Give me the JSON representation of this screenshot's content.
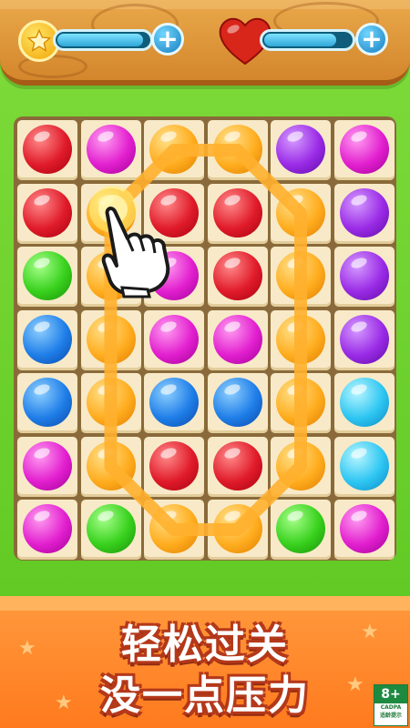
{
  "hud": {
    "star_meter_level": 0.9,
    "life_meter_level": 0.8,
    "star_plus": "+",
    "life_plus": "+"
  },
  "board": {
    "rows": 7,
    "cols": 6,
    "grid": [
      [
        "red",
        "magenta",
        "orange",
        "orange",
        "purple",
        "magenta"
      ],
      [
        "red",
        "orange",
        "red",
        "red",
        "orange",
        "purple"
      ],
      [
        "green",
        "orange",
        "magenta",
        "red",
        "orange",
        "purple"
      ],
      [
        "blue",
        "orange",
        "magenta",
        "magenta",
        "orange",
        "purple"
      ],
      [
        "blue",
        "orange",
        "blue",
        "blue",
        "orange",
        "cyan"
      ],
      [
        "magenta",
        "orange",
        "red",
        "red",
        "orange",
        "cyan"
      ],
      [
        "magenta",
        "green",
        "orange",
        "orange",
        "green",
        "magenta"
      ]
    ],
    "colors": {
      "red": "#e01b2a",
      "magenta": "#e21fcf",
      "orange": "#ffad1f",
      "purple": "#9a2be6",
      "green": "#38d11d",
      "blue": "#1f7ee8",
      "cyan": "#2ec6f2"
    }
  },
  "banner": {
    "line1": "轻松过关",
    "line2": "没一点压力"
  },
  "age_rating": {
    "rating": "8+",
    "org": "CADPA",
    "note": "适龄提示"
  }
}
